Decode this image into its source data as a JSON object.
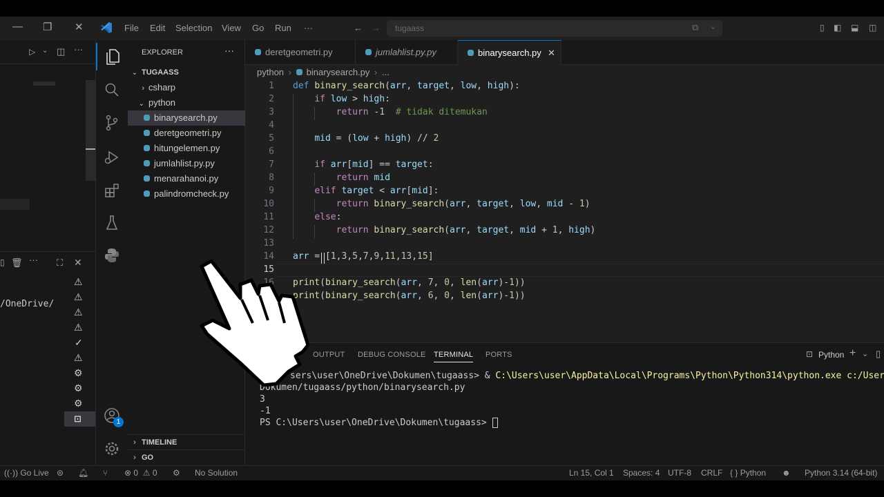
{
  "titlebar": {
    "menus": [
      "File",
      "Edit",
      "Selection",
      "View",
      "Go",
      "Run"
    ],
    "more": "···",
    "search_text": "tugaass"
  },
  "leftpanel": {
    "terminal_path_fragment": "/OneDrive/"
  },
  "explorer": {
    "header": "EXPLORER",
    "more": "···",
    "workspace": "TUGAASS",
    "folders": [
      "csharp",
      "python"
    ],
    "files": [
      "binarysearch.py",
      "deretgeometri.py",
      "hitungelemen.py",
      "jumlahlist.py.py",
      "menarahanoi.py",
      "palindromcheck.py"
    ],
    "timeline": "TIMELINE",
    "go": "GO"
  },
  "tabs": [
    {
      "label": "deretgeometri.py"
    },
    {
      "label": "jumlahlist.py.py"
    },
    {
      "label": "binarysearch.py"
    }
  ],
  "breadcrumb": {
    "folder": "python",
    "file": "binarysearch.py",
    "rest": "..."
  },
  "editor": {
    "line_numbers": [
      "1",
      "2",
      "3",
      "4",
      "5",
      "6",
      "7",
      "8",
      "9",
      "10",
      "11",
      "12",
      "13",
      "14",
      "15",
      "16",
      "17"
    ],
    "current_line": "15"
  },
  "panel": {
    "tabs": [
      "OUTPUT",
      "DEBUG CONSOLE",
      "TERMINAL",
      "PORTS"
    ],
    "active_tab": "TERMINAL",
    "shell": "Python",
    "terminal_lines": [
      "sers\\user\\OneDrive\\Dokumen\\tugaass> & ",
      "C:\\Users\\user\\AppData\\Local\\Programs\\Python\\Python314\\python.exe c:/Users/user/",
      "Dokumen/tugaass/python/binarysearch.py",
      "3",
      "-1",
      "PS C:\\Users\\user\\OneDrive\\Dokumen\\tugaass> "
    ]
  },
  "statusbar": {
    "go_live": "Go Live",
    "errors": "0",
    "warnings": "0",
    "no_solution": "No Solution",
    "position": "Ln 15, Col 1",
    "spaces": "Spaces: 4",
    "encoding": "UTF-8",
    "eol": "CRLF",
    "language": "Python",
    "interpreter": "Python 3.14 (64-bit)"
  },
  "badges": {
    "accounts": "1"
  },
  "colors": {
    "accent": "#0078d4",
    "python_icon": "#519aba"
  }
}
